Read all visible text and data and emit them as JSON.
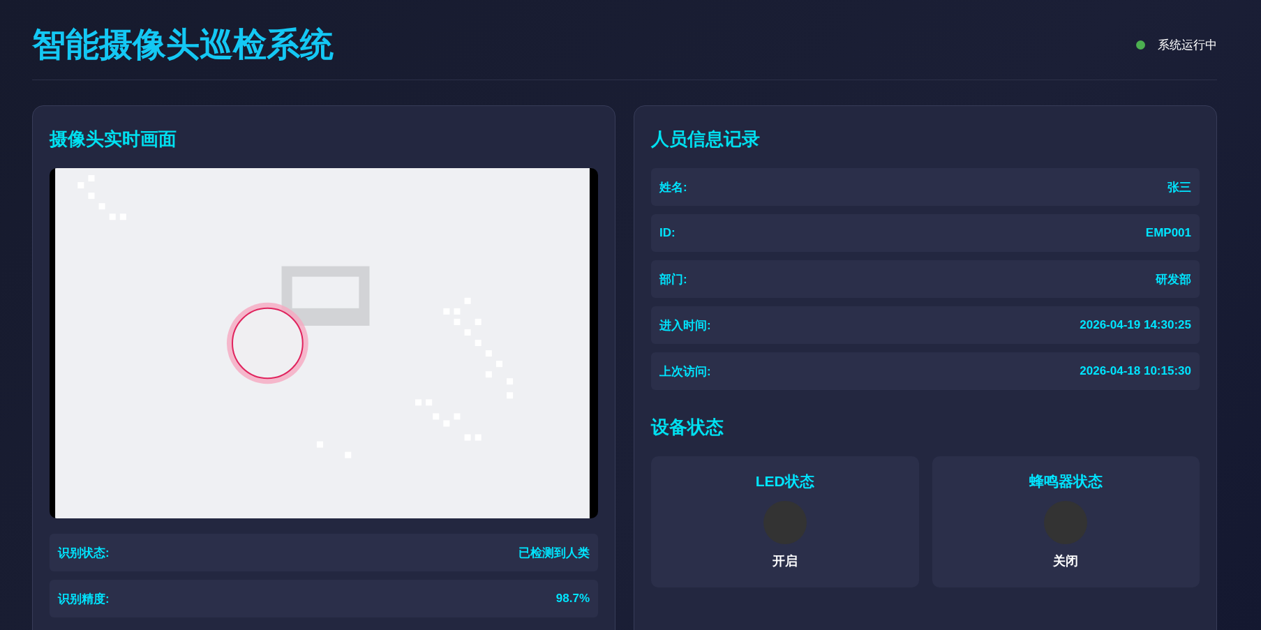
{
  "header": {
    "title": "智能摄像头巡检系统",
    "status": "系统运行中"
  },
  "camera_panel": {
    "title": "摄像头实时画面",
    "fields": [
      {
        "label": "识别状态:",
        "value": "已检测到人类"
      },
      {
        "label": "识别精度:",
        "value": "98.7%"
      }
    ]
  },
  "person_panel": {
    "title": "人员信息记录",
    "fields": [
      {
        "label": "姓名:",
        "value": "张三"
      },
      {
        "label": "ID:",
        "value": "EMP001"
      },
      {
        "label": "部门:",
        "value": "研发部"
      },
      {
        "label": "进入时间:",
        "value": "2026-04-19 14:30:25"
      },
      {
        "label": "上次访问:",
        "value": "2026-04-18 10:15:30"
      }
    ]
  },
  "devices": {
    "title": "设备状态",
    "items": [
      {
        "name": "LED状态",
        "status": "开启"
      },
      {
        "name": "蜂鸣器状态",
        "status": "关闭"
      }
    ]
  }
}
